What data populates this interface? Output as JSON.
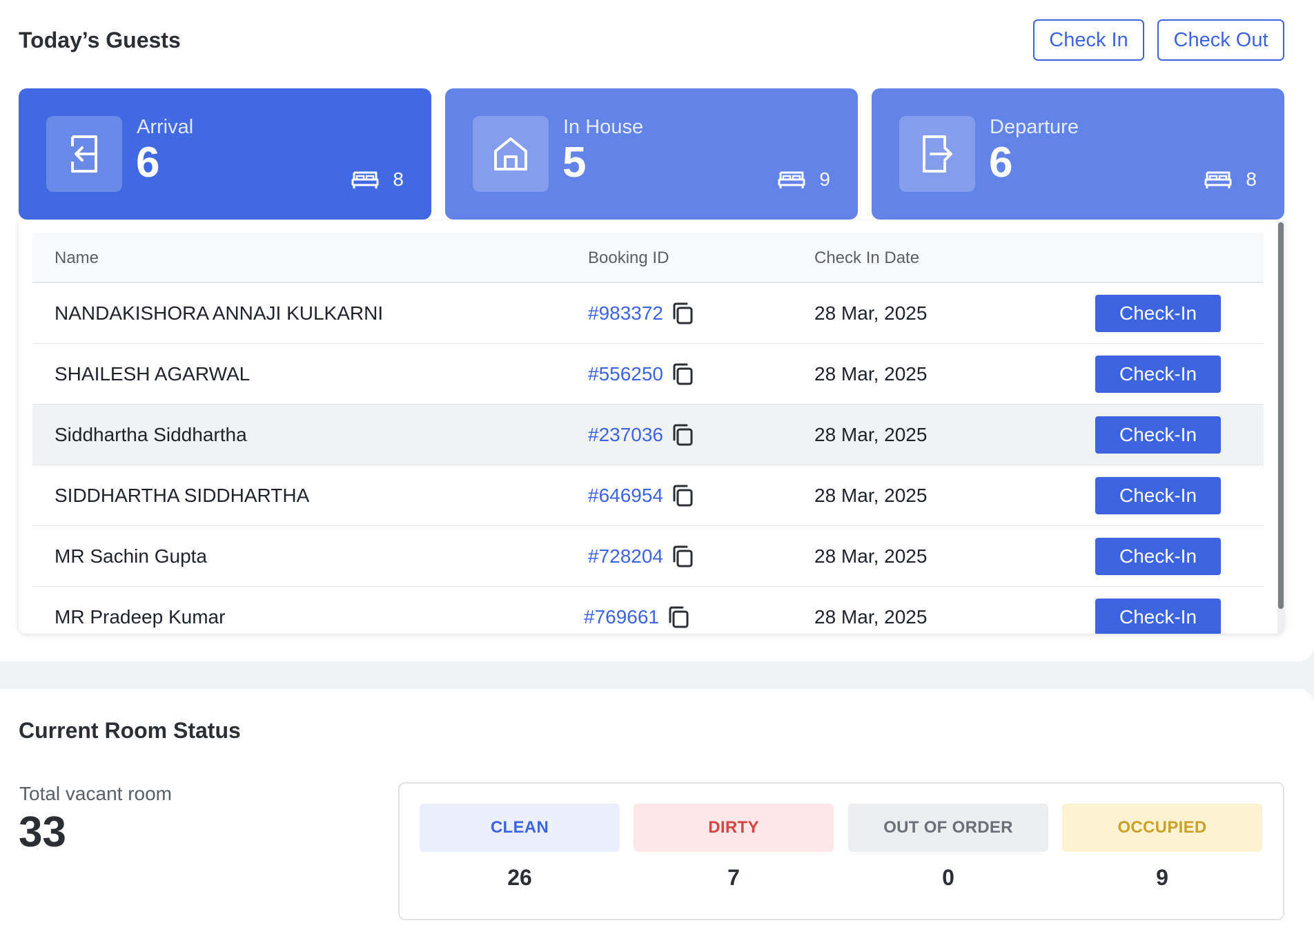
{
  "guests": {
    "title": "Today’s Guests",
    "check_in_label": "Check In",
    "check_out_label": "Check Out",
    "cards": [
      {
        "label": "Arrival",
        "count": "6",
        "rooms": "8",
        "icon": "arrow-enter-icon"
      },
      {
        "label": "In House",
        "count": "5",
        "rooms": "9",
        "icon": "house-icon"
      },
      {
        "label": "Departure",
        "count": "6",
        "rooms": "8",
        "icon": "arrow-exit-icon"
      }
    ],
    "table": {
      "headers": {
        "name": "Name",
        "booking_id": "Booking ID",
        "check_in_date": "Check In Date"
      },
      "rows": [
        {
          "name": "NANDAKISHORA ANNAJI KULKARNI",
          "booking_id": "#983372",
          "date": "28 Mar, 2025",
          "action": "Check-In"
        },
        {
          "name": "SHAILESH AGARWAL",
          "booking_id": "#556250",
          "date": "28 Mar, 2025",
          "action": "Check-In"
        },
        {
          "name": "Siddhartha Siddhartha",
          "booking_id": "#237036",
          "date": "28 Mar, 2025",
          "action": "Check-In"
        },
        {
          "name": "SIDDHARTHA SIDDHARTHA",
          "booking_id": "#646954",
          "date": "28 Mar, 2025",
          "action": "Check-In"
        },
        {
          "name": "MR Sachin Gupta",
          "booking_id": "#728204",
          "date": "28 Mar, 2025",
          "action": "Check-In"
        },
        {
          "name": "MR Pradeep Kumar",
          "booking_id": "#769661",
          "date": "28 Mar, 2025",
          "action": "Check-In"
        }
      ]
    }
  },
  "room_status": {
    "title": "Current Room Status",
    "vacant_label": "Total vacant room",
    "vacant_count": "33",
    "statuses": [
      {
        "label": "CLEAN",
        "value": "26",
        "bg": "#ebf0fc",
        "color": "#3c64e0"
      },
      {
        "label": "DIRTY",
        "value": "7",
        "bg": "#fce8e8",
        "color": "#d64545"
      },
      {
        "label": "OUT OF ORDER",
        "value": "0",
        "bg": "#eceef0",
        "color": "#6b7078"
      },
      {
        "label": "OCCUPIED",
        "value": "9",
        "bg": "#fdf3d2",
        "color": "#c9a227"
      }
    ]
  },
  "colors": {
    "accent": "#3c64e0",
    "card_primary": "#4169e1",
    "card_light": "#6283e8"
  }
}
